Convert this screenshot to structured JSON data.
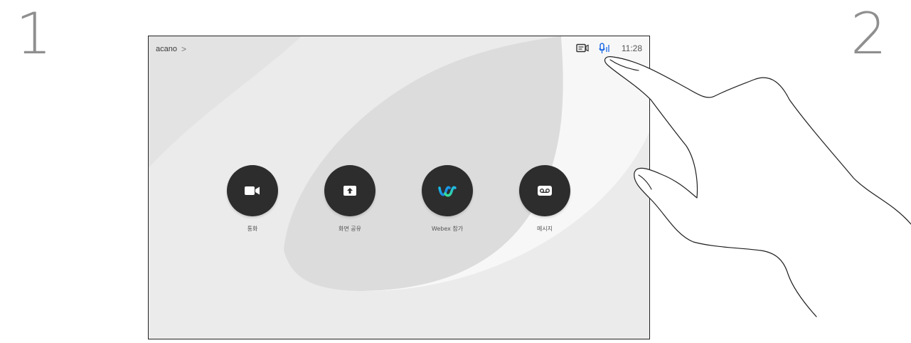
{
  "steps": {
    "first": "1",
    "second": "2"
  },
  "header": {
    "title": "acano",
    "chevron": ">"
  },
  "status": {
    "time": "11:28",
    "icons": [
      "screen-share-status-icon",
      "microphone-status-icon"
    ],
    "accent_color": "#1d6ae5"
  },
  "actions": [
    {
      "label": "통화",
      "icon": "video-camera-icon"
    },
    {
      "label": "화면 공유",
      "icon": "share-upload-icon"
    },
    {
      "label": "Webex 참가",
      "icon": "webex-logo-icon"
    },
    {
      "label": "메시지",
      "icon": "voicemail-icon"
    }
  ],
  "colors": {
    "button_bg": "#2d2d2d",
    "label_text": "#555555",
    "step_number": "#8f8f8f"
  }
}
